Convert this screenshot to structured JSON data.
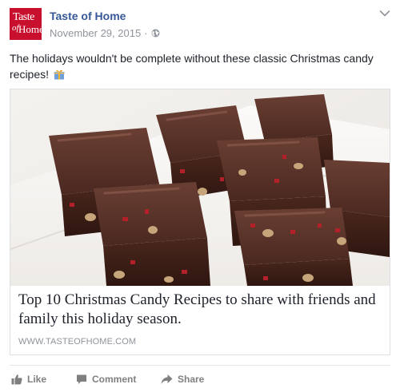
{
  "post": {
    "page_name": "Taste of Home",
    "date": "November 29, 2015",
    "separator": "·",
    "logo": {
      "line1": "Taste",
      "line2": "of",
      "line3": "Home",
      "color": "#c8102e"
    },
    "message": "The holidays wouldn't be complete without these classic Christmas candy recipes!",
    "message_icon": "gift-icon",
    "privacy_icon": "globe-icon",
    "options_icon": "chevron-down-icon"
  },
  "link_card": {
    "image_subject": "chocolate-fudge-squares-photo",
    "title": "Top 10 Christmas Candy Recipes to share with friends and family this holiday season.",
    "url": "WWW.TASTEOFHOME.COM"
  },
  "actions": {
    "like": "Like",
    "comment": "Comment",
    "share": "Share"
  },
  "colors": {
    "link_blue": "#365899",
    "meta_gray": "#90949c",
    "action_gray": "#7f7f7f",
    "border": "#dddfe2"
  }
}
